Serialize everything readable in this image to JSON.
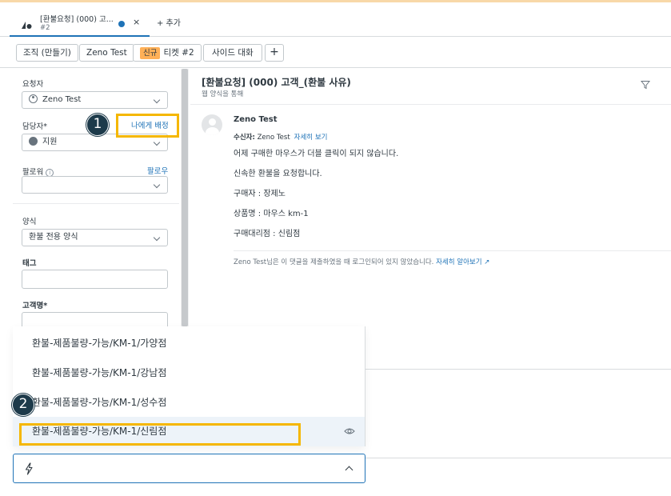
{
  "tab": {
    "title": "[환불요청] (000) 고...",
    "subtitle": "#2",
    "close": "×",
    "add_label": "+ 추가"
  },
  "breadcrumbs": {
    "org": "조직 (만들기)",
    "user": "Zeno Test",
    "status_badge": "신규",
    "ticket": "티켓 #2",
    "side_conversation": "사이드 대화",
    "plus": "+"
  },
  "sidebar": {
    "requester_label": "요청자",
    "requester_value": "Zeno Test",
    "assignee_label": "담당자*",
    "assign_to_me": "나에게 배정",
    "assignee_value": "지원",
    "followers_label": "팔로워",
    "follow_link": "팔로우",
    "form_label": "양식",
    "form_value": "환불 전용 양식",
    "tags_label": "태그",
    "customer_name_label": "고객명*"
  },
  "ticket": {
    "subject": "[환불요청] (000) 고객_(환불 사유)",
    "via": "웹 양식을 통해",
    "author": "Zeno Test",
    "recipient_label": "수신자:",
    "recipient_value": "Zeno Test",
    "recipient_more": "자세히 보기",
    "body": [
      "어제 구매한 마우스가 더블 클릭이 되지 않습니다.",
      "신속한 환불을 요청합니다.",
      "구매자 : 장제노",
      "상품명 : 마우스 km-1",
      "구매대리점 : 신림점"
    ],
    "notice_text": "Zeno Test님은 이 댓글을 제출하였을 때 로그인되어 있지 않았습니다.",
    "notice_link": "자세히 알아보기"
  },
  "dropdown": {
    "options": [
      "환불-제품불량-가능/KM-1/가양점",
      "환불-제품불량-가능/KM-1/강남점",
      "환불-제품불량-가능/KM-1/성수점",
      "환불-제품불량-가능/KM-1/신림점"
    ],
    "highlighted_index": 3
  },
  "annotations": {
    "step1": "1",
    "step2": "2"
  },
  "colors": {
    "accent_blue": "#1f73b7",
    "highlight_yellow": "#f5b700",
    "badge_orange": "#ffb057",
    "step_circle": "#1d3a4a"
  }
}
